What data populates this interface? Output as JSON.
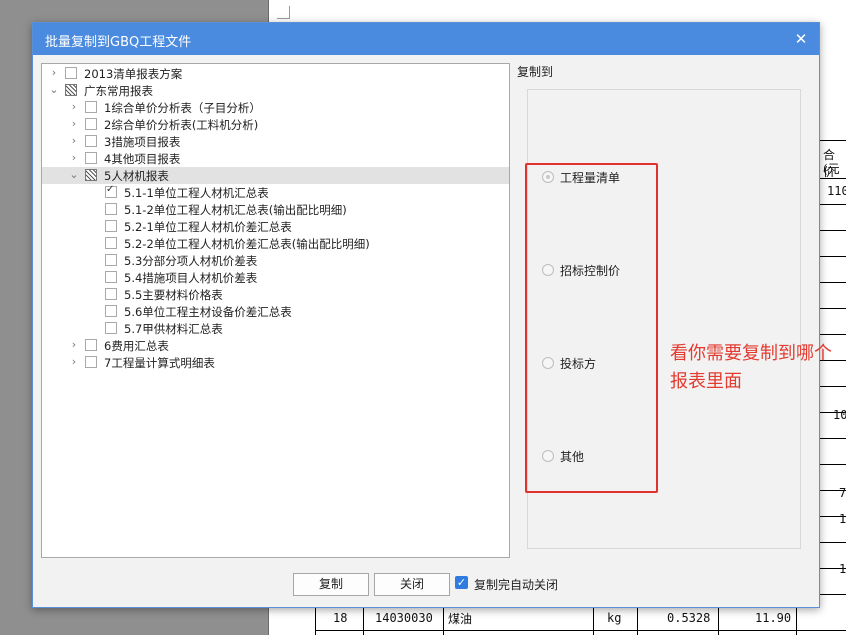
{
  "dialog": {
    "title": "批量复制到GBQ工程文件",
    "close_glyph": "✕",
    "copy_to_label": "复制到",
    "options": [
      "工程量清单",
      "招标控制价",
      "投标方",
      "其他"
    ],
    "selected_option": 0,
    "buttons": {
      "copy": "复制",
      "close": "关闭"
    },
    "auto_close": {
      "label": "复制完自动关闭",
      "checked": true
    }
  },
  "tree": [
    {
      "label": "2013清单报表方案",
      "level": 0,
      "expander": "collapsed",
      "check": "unchecked",
      "selected": false
    },
    {
      "label": "广东常用报表",
      "level": 0,
      "expander": "expanded",
      "check": "partial",
      "selected": false
    },
    {
      "label": "1综合单价分析表（子目分析）",
      "level": 1,
      "expander": "collapsed",
      "check": "unchecked",
      "selected": false
    },
    {
      "label": "2综合单价分析表(工料机分析)",
      "level": 1,
      "expander": "collapsed",
      "check": "unchecked",
      "selected": false
    },
    {
      "label": "3措施项目报表",
      "level": 1,
      "expander": "collapsed",
      "check": "unchecked",
      "selected": false
    },
    {
      "label": "4其他项目报表",
      "level": 1,
      "expander": "collapsed",
      "check": "unchecked",
      "selected": false
    },
    {
      "label": "5人材机报表",
      "level": 1,
      "expander": "expanded",
      "check": "partial",
      "selected": true
    },
    {
      "label": "5.1-1单位工程人材机汇总表",
      "level": 2,
      "expander": "none",
      "check": "checked",
      "selected": false
    },
    {
      "label": "5.1-2单位工程人材机汇总表(输出配比明细)",
      "level": 2,
      "expander": "none",
      "check": "unchecked",
      "selected": false
    },
    {
      "label": "5.2-1单位工程人材机价差汇总表",
      "level": 2,
      "expander": "none",
      "check": "unchecked",
      "selected": false
    },
    {
      "label": "5.2-2单位工程人材机价差汇总表(输出配比明细)",
      "level": 2,
      "expander": "none",
      "check": "unchecked",
      "selected": false
    },
    {
      "label": "5.3分部分项人材机价差表",
      "level": 2,
      "expander": "none",
      "check": "unchecked",
      "selected": false
    },
    {
      "label": "5.4措施项目人材机价差表",
      "level": 2,
      "expander": "none",
      "check": "unchecked",
      "selected": false
    },
    {
      "label": "5.5主要材料价格表",
      "level": 2,
      "expander": "none",
      "check": "unchecked",
      "selected": false
    },
    {
      "label": "5.6单位工程主材设备价差汇总表",
      "level": 2,
      "expander": "none",
      "check": "unchecked",
      "selected": false
    },
    {
      "label": "5.7甲供材料汇总表",
      "level": 2,
      "expander": "none",
      "check": "unchecked",
      "selected": false
    },
    {
      "label": "6费用汇总表",
      "level": 1,
      "expander": "collapsed",
      "check": "unchecked",
      "selected": false
    },
    {
      "label": "7工程量计算式明细表",
      "level": 1,
      "expander": "collapsed",
      "check": "unchecked",
      "selected": false
    }
  ],
  "annotation": {
    "text": "看你需要复制到哪个报表里面",
    "color": "#e33b30"
  },
  "background_doc": {
    "header_line1": "合价",
    "header_line2": "(元",
    "right_col_values": [
      "110",
      "10",
      "7",
      "1",
      "1"
    ],
    "last_row": {
      "no": "18",
      "code": "14030030",
      "name": "煤油",
      "unit": "kg",
      "qty": "0.5328",
      "price": "11.90"
    }
  },
  "colors": {
    "titlebar": "#4a8be0",
    "highlight": "#e0322e",
    "checkbox_accent": "#2f7be0"
  }
}
